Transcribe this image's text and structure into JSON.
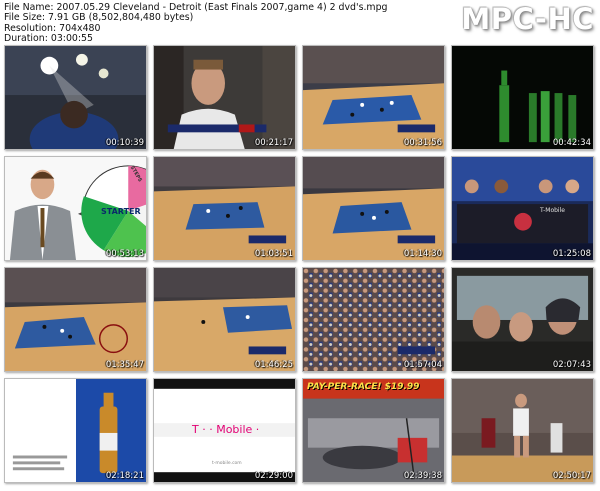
{
  "header": {
    "file_name": "File Name: 2007.05.29 Cleveland - Detroit (East Finals 2007,game 4) 2 dvd's.mpg",
    "file_size": "File Size: 7.91 GB (8,502,804,480 bytes)",
    "resolution": "Resolution: 704x480",
    "duration": "Duration: 03:00:55"
  },
  "logo": "MPC-HC",
  "thumbnails": [
    {
      "timestamp": "00:10:39",
      "scene": "arena-lights"
    },
    {
      "timestamp": "00:21:17",
      "scene": "player-closeup"
    },
    {
      "timestamp": "00:31:56",
      "scene": "court-wide"
    },
    {
      "timestamp": "00:42:34",
      "scene": "green-bottles"
    },
    {
      "timestamp": "00:53:13",
      "scene": "man-with-wheel",
      "overlay_text": "STARTER",
      "overlay_text2": "STEPS"
    },
    {
      "timestamp": "01:03:51",
      "scene": "court-wide"
    },
    {
      "timestamp": "01:14:30",
      "scene": "court-wide"
    },
    {
      "timestamp": "01:25:08",
      "scene": "studio-desk",
      "overlay_text": "T-Mobile"
    },
    {
      "timestamp": "01:35:47",
      "scene": "court-wide"
    },
    {
      "timestamp": "01:46:25",
      "scene": "court-wide"
    },
    {
      "timestamp": "01:57:04",
      "scene": "crowd"
    },
    {
      "timestamp": "02:07:43",
      "scene": "car-interior"
    },
    {
      "timestamp": "02:18:21",
      "scene": "beer-ad"
    },
    {
      "timestamp": "02:29:00",
      "scene": "tmobile-ad",
      "overlay_text": "T · · Mobile ·",
      "overlay_text2": "t-mobile.com"
    },
    {
      "timestamp": "02:39:38",
      "scene": "pay-per-race",
      "overlay_text": "PAY-PER-RACE! $19.99"
    },
    {
      "timestamp": "02:50:17",
      "scene": "court-closeup"
    }
  ]
}
